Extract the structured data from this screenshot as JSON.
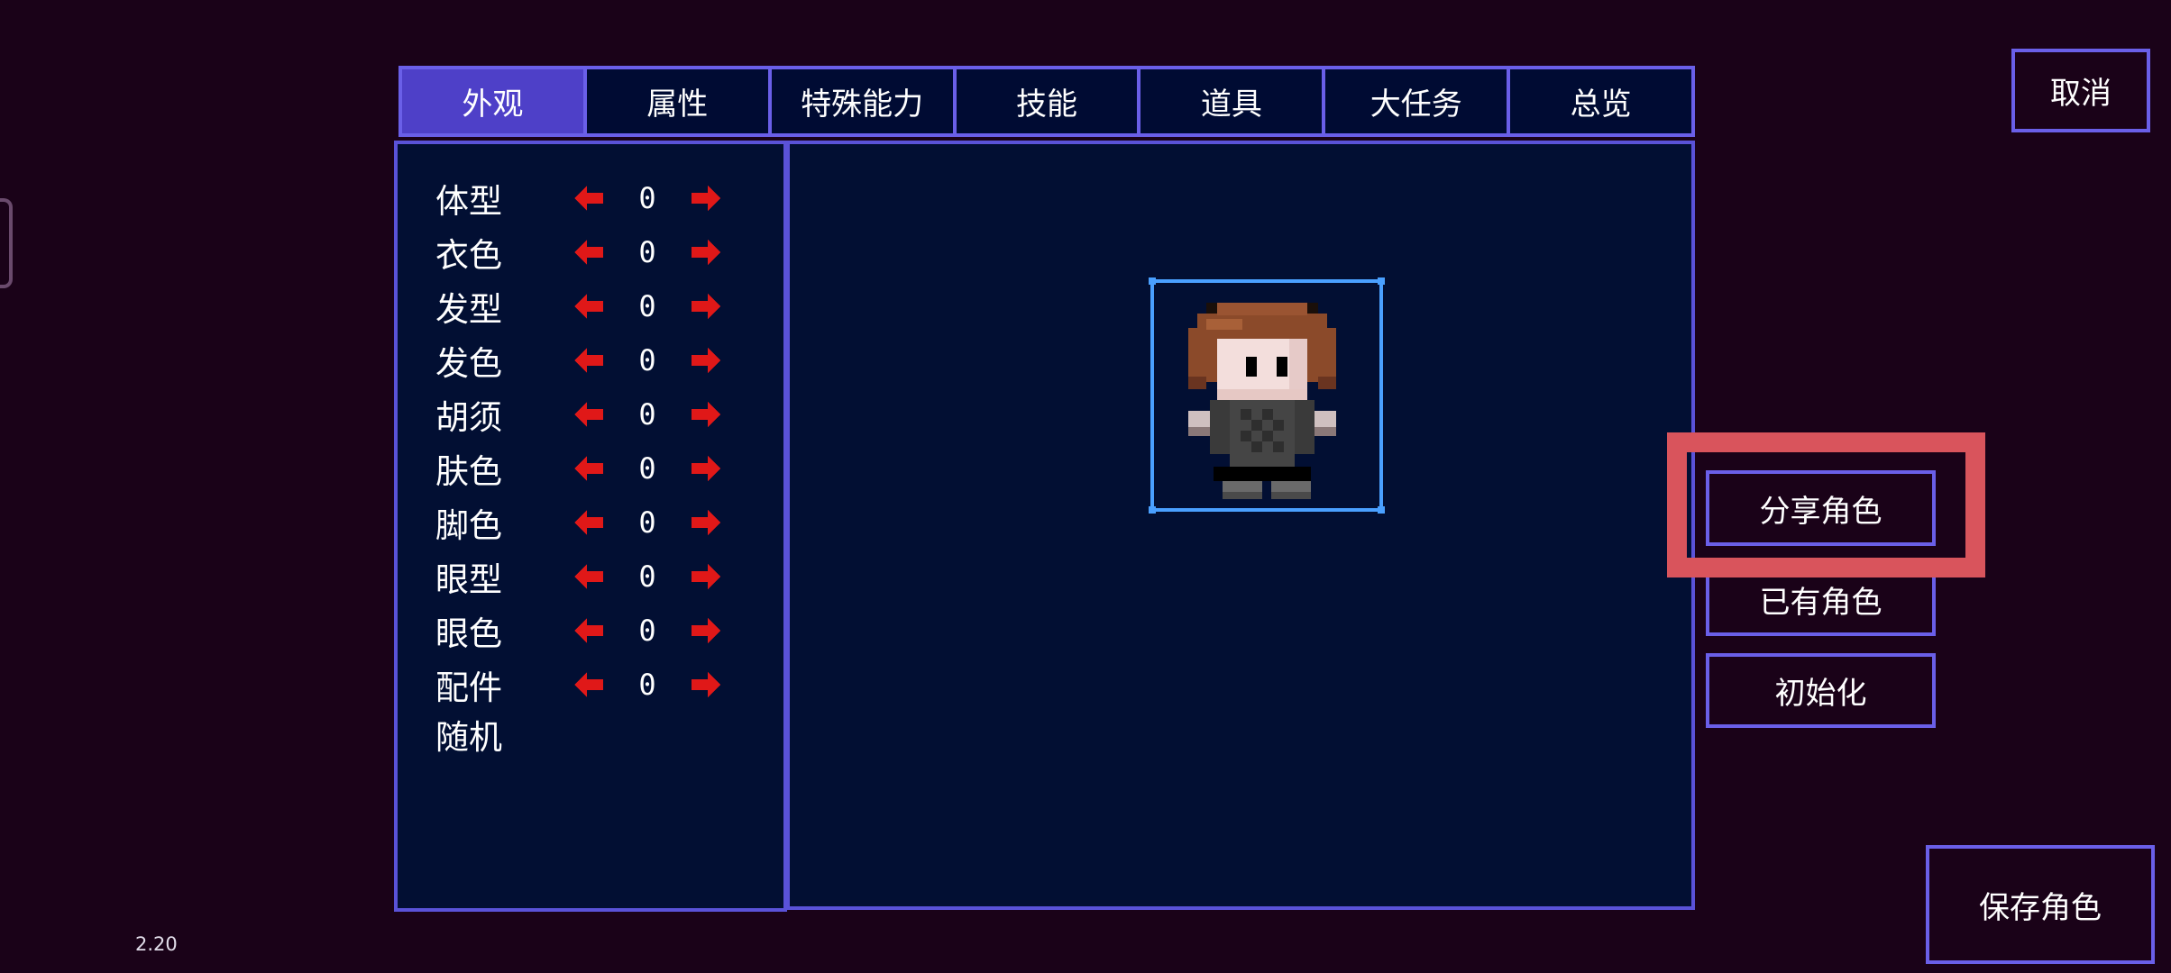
{
  "tabs": [
    {
      "label": "外观",
      "active": true
    },
    {
      "label": "属性",
      "active": false
    },
    {
      "label": "特殊能力",
      "active": false
    },
    {
      "label": "技能",
      "active": false
    },
    {
      "label": "道具",
      "active": false
    },
    {
      "label": "大任务",
      "active": false
    },
    {
      "label": "总览",
      "active": false
    }
  ],
  "attributes": [
    {
      "label": "体型",
      "value": "0"
    },
    {
      "label": "衣色",
      "value": "0"
    },
    {
      "label": "发型",
      "value": "0"
    },
    {
      "label": "发色",
      "value": "0"
    },
    {
      "label": "胡须",
      "value": "0"
    },
    {
      "label": "肤色",
      "value": "0"
    },
    {
      "label": "脚色",
      "value": "0"
    },
    {
      "label": "眼型",
      "value": "0"
    },
    {
      "label": "眼色",
      "value": "0"
    },
    {
      "label": "配件",
      "value": "0"
    }
  ],
  "random_label": "随机",
  "buttons": {
    "cancel": "取消",
    "share": "分享角色",
    "existing": "已有角色",
    "reset": "初始化",
    "save": "保存角色"
  },
  "version": "2.20",
  "colors": {
    "background": "#1a0218",
    "panel": "#020f33",
    "border": "#6a5fe8",
    "tab_active": "#4e40c8",
    "arrow": "#e01818",
    "highlight": "#d9545c",
    "portrait_border": "#4aa0ff"
  },
  "icons": {
    "left_arrow": "red-left-arrow-icon",
    "right_arrow": "red-right-arrow-icon"
  }
}
